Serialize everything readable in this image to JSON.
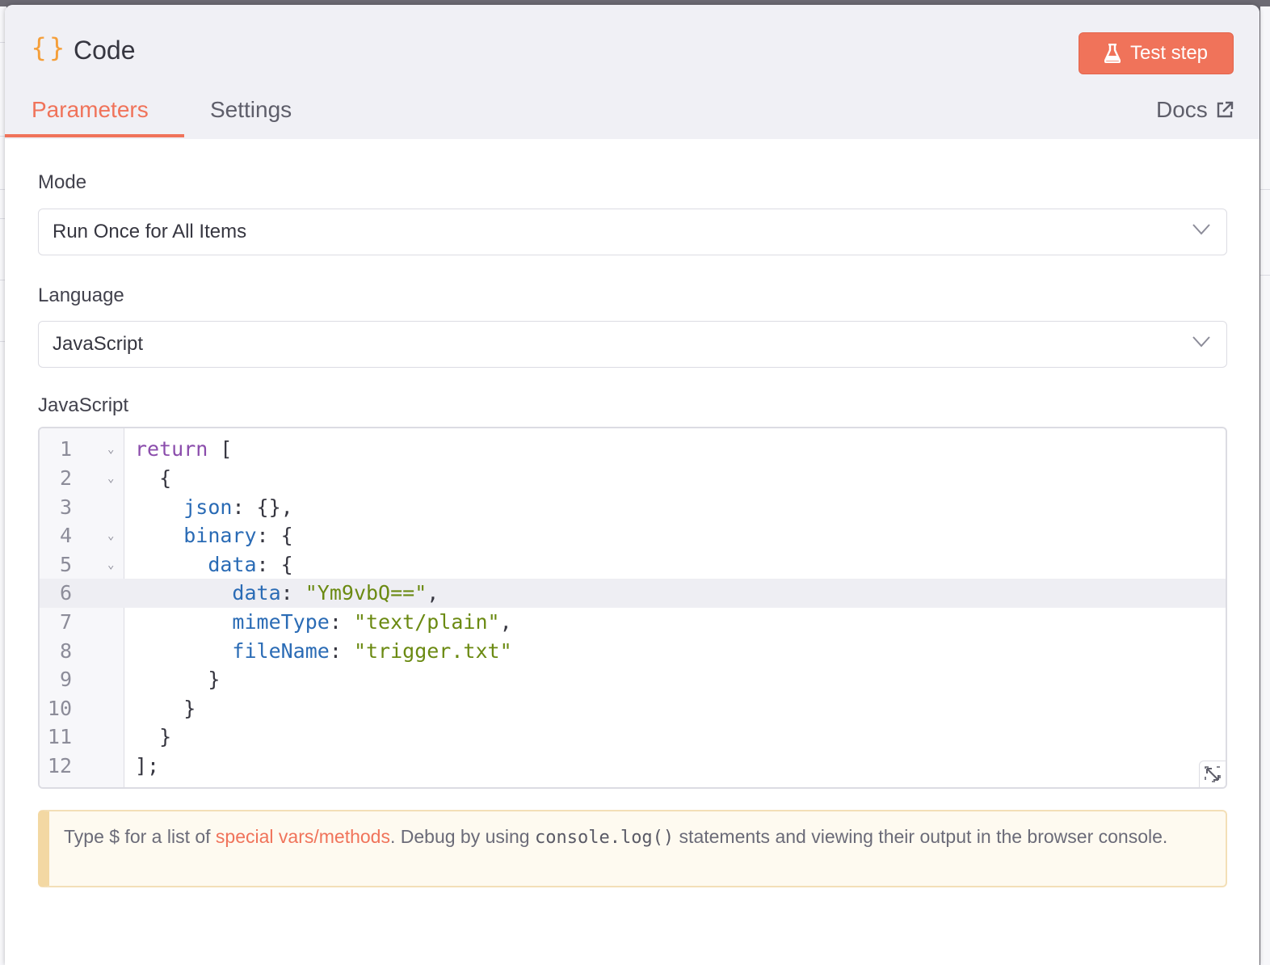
{
  "node": {
    "icon": "curly-braces-icon",
    "icon_glyph": "{}",
    "title": "Code",
    "test_button_label": "Test step",
    "accent_color": "#f0735a"
  },
  "tabs": [
    {
      "label": "Parameters",
      "active": true
    },
    {
      "label": "Settings",
      "active": false
    }
  ],
  "docs_label": "Docs",
  "mode": {
    "label": "Mode",
    "value": "Run Once for All Items"
  },
  "language": {
    "label": "Language",
    "value": "JavaScript"
  },
  "editor": {
    "label": "JavaScript",
    "active_line": 6,
    "lines": [
      {
        "n": "1",
        "fold": true
      },
      {
        "n": "2",
        "fold": true
      },
      {
        "n": "3",
        "fold": false
      },
      {
        "n": "4",
        "fold": true
      },
      {
        "n": "5",
        "fold": true
      },
      {
        "n": "6",
        "fold": false
      },
      {
        "n": "7",
        "fold": false
      },
      {
        "n": "8",
        "fold": false
      },
      {
        "n": "9",
        "fold": false
      },
      {
        "n": "10",
        "fold": false
      },
      {
        "n": "11",
        "fold": false
      },
      {
        "n": "12",
        "fold": false
      }
    ],
    "tokens": {
      "return_kw": "return",
      "open_bracket": " [",
      "open_brace": "{",
      "json_key": "json",
      "json_rest": ": {},",
      "binary_key": "binary",
      "binary_rest": ": {",
      "data_key": "data",
      "data_rest": ": {",
      "inner_data_key": "data",
      "colon": ": ",
      "inner_data_value": "\"Ym9vbQ==\"",
      "comma": ",",
      "mime_key": "mimeType",
      "mime_value": "\"text/plain\"",
      "file_key": "fileName",
      "file_value": "\"trigger.txt\"",
      "close_brace": "}",
      "close_array": "];"
    }
  },
  "notice": {
    "prefix": "Type $ for a list of ",
    "link": "special vars/methods",
    "middle": ". Debug by using ",
    "code": "console.log()",
    "suffix": " statements and viewing their output in the browser console."
  }
}
